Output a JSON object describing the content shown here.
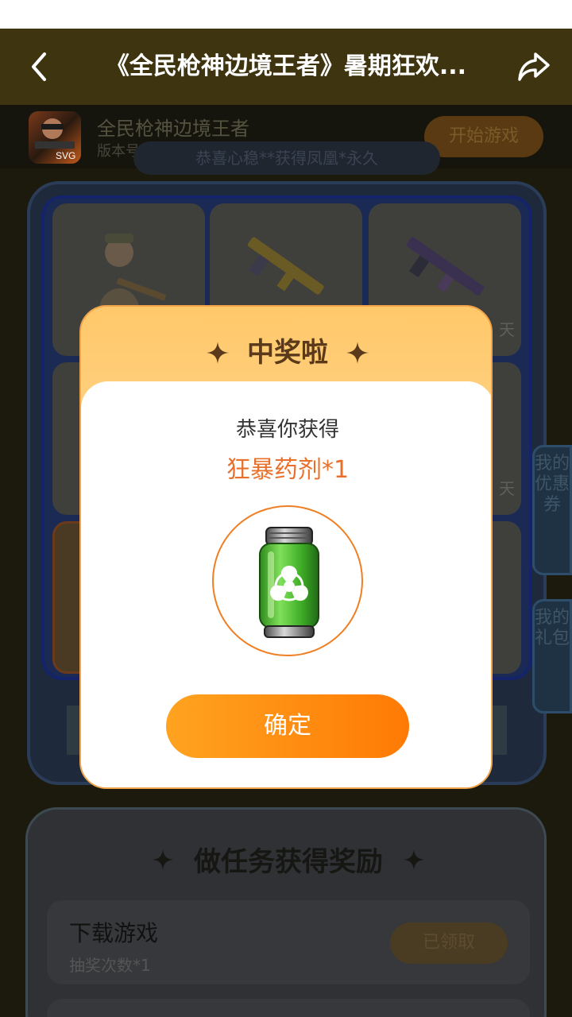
{
  "header": {
    "title": "《全民枪神边境王者》暑期狂欢..."
  },
  "game": {
    "name": "全民枪神边境王者",
    "version": "版本号：2.0",
    "start_label": "开始游戏"
  },
  "ticker": {
    "text": "恭喜心稳**获得凤凰*永久"
  },
  "lottery": {
    "cell_labels": [
      "天",
      "天"
    ]
  },
  "side_tabs": {
    "coupons": "我的优惠券",
    "gifts": "我的礼包"
  },
  "tasks": {
    "title": "做任务获得奖励",
    "items": [
      {
        "name": "下载游戏",
        "sub": "抽奖次数*1",
        "button": "已领取"
      }
    ]
  },
  "modal": {
    "title": "中奖啦",
    "congrats": "恭喜你获得",
    "prize": "狂暴药剂*1",
    "confirm_label": "确定"
  },
  "colors": {
    "accent_orange": "#ff7a05",
    "prize_text": "#e8702a",
    "header_bg": "#3e3410"
  },
  "icons": {
    "back": "chevron-left-icon",
    "share": "share-arrow-icon",
    "sparkle": "sparkle-star-icon",
    "prize": "biohazard-potion-icon"
  }
}
